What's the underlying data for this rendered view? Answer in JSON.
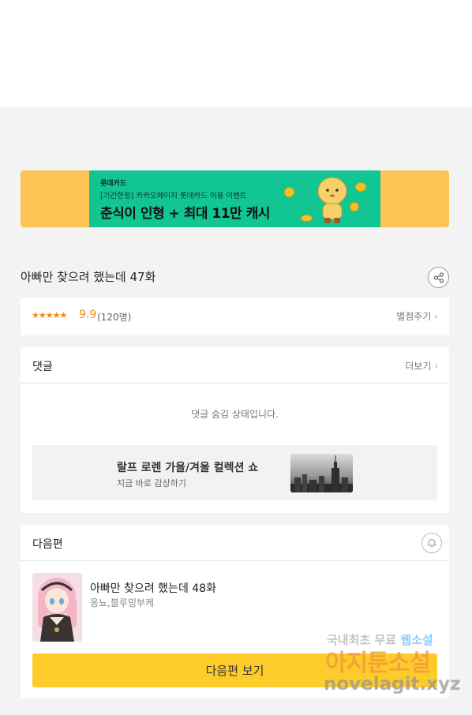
{
  "banner": {
    "brand": "롯데카드",
    "subtitle": "[기간한정] 카카오페이지 롯데카드 이용 이벤트",
    "headline": "춘식이 인형 + 최대 11만 캐시",
    "colors": {
      "outer": "#fcc455",
      "inner": "#12c693"
    }
  },
  "episode": {
    "title": "아빠만 찾으려 했는데 47화",
    "share_icon": "share-icon"
  },
  "rating": {
    "stars": "★★★★★",
    "score": "9.9",
    "count": "(120명)",
    "rate_link": "별점주기"
  },
  "comments": {
    "title": "댓글",
    "more_link": "더보기",
    "hidden_message": "댓글 숨김 상태입니다."
  },
  "ad": {
    "title": "랄프 로렌 가을/겨울 컬렉션 쇼",
    "subtitle": "지금 바로 감상하기"
  },
  "next": {
    "section_title": "다음편",
    "bell_icon": "bell-icon",
    "episode_title": "아빠만 찾으려 했는데 48화",
    "author": "옹뇨,블루밍부케",
    "button_label": "다음편 보기",
    "accent": "#fdcb2a"
  },
  "watermark": {
    "line1_a": "국내최초 무료",
    "line1_b": "웹소설",
    "line2": "아지툰소설",
    "line3": "novelagit.xyz"
  }
}
